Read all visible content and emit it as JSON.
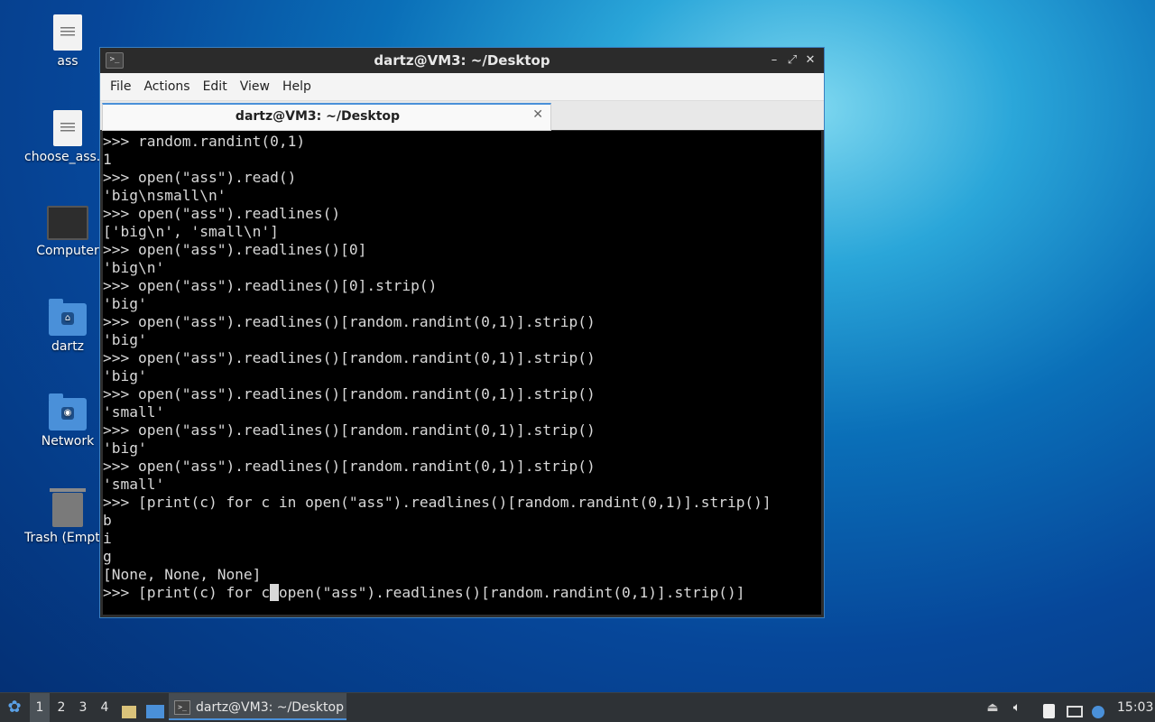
{
  "desktop": {
    "icons": [
      {
        "label": "ass",
        "icon": "text-file-icon"
      },
      {
        "label": "choose_ass.py",
        "icon": "text-file-icon"
      },
      {
        "label": "Computer",
        "icon": "computer-icon"
      },
      {
        "label": "dartz",
        "icon": "home-folder-icon"
      },
      {
        "label": "Network",
        "icon": "network-folder-icon"
      },
      {
        "label": "Trash (Empty)",
        "icon": "trash-icon"
      }
    ]
  },
  "window": {
    "title": "dartz@VM3: ~/Desktop",
    "menu": [
      "File",
      "Actions",
      "Edit",
      "View",
      "Help"
    ],
    "tab_label": "dartz@VM3: ~/Desktop",
    "terminal_lines": [
      ">>> random.randint(0,1)",
      "1",
      ">>> open(\"ass\").read()",
      "'big\\nsmall\\n'",
      ">>> open(\"ass\").readlines()",
      "['big\\n', 'small\\n']",
      ">>> open(\"ass\").readlines()[0]",
      "'big\\n'",
      ">>> open(\"ass\").readlines()[0].strip()",
      "'big'",
      ">>> open(\"ass\").readlines()[random.randint(0,1)].strip()",
      "'big'",
      ">>> open(\"ass\").readlines()[random.randint(0,1)].strip()",
      "'big'",
      ">>> open(\"ass\").readlines()[random.randint(0,1)].strip()",
      "'small'",
      ">>> open(\"ass\").readlines()[random.randint(0,1)].strip()",
      "'big'",
      ">>> open(\"ass\").readlines()[random.randint(0,1)].strip()",
      "'small'",
      ">>> [print(c) for c in open(\"ass\").readlines()[random.randint(0,1)].strip()]",
      "b",
      "i",
      "g",
      "[None, None, None]"
    ],
    "current_input_before": ">>> [print(c) for c",
    "cursor_char": " ",
    "current_input_after": "open(\"ass\").readlines()[random.randint(0,1)].strip()]"
  },
  "taskbar": {
    "workspaces": [
      "1",
      "2",
      "3",
      "4"
    ],
    "active_workspace": "1",
    "task_label": "dartz@VM3: ~/Desktop",
    "clock": "15:03"
  },
  "colors": {
    "accent": "#4a90d9",
    "terminal_bg": "#000000",
    "terminal_fg": "#d8d8d8",
    "taskbar_bg": "#2e3236"
  }
}
